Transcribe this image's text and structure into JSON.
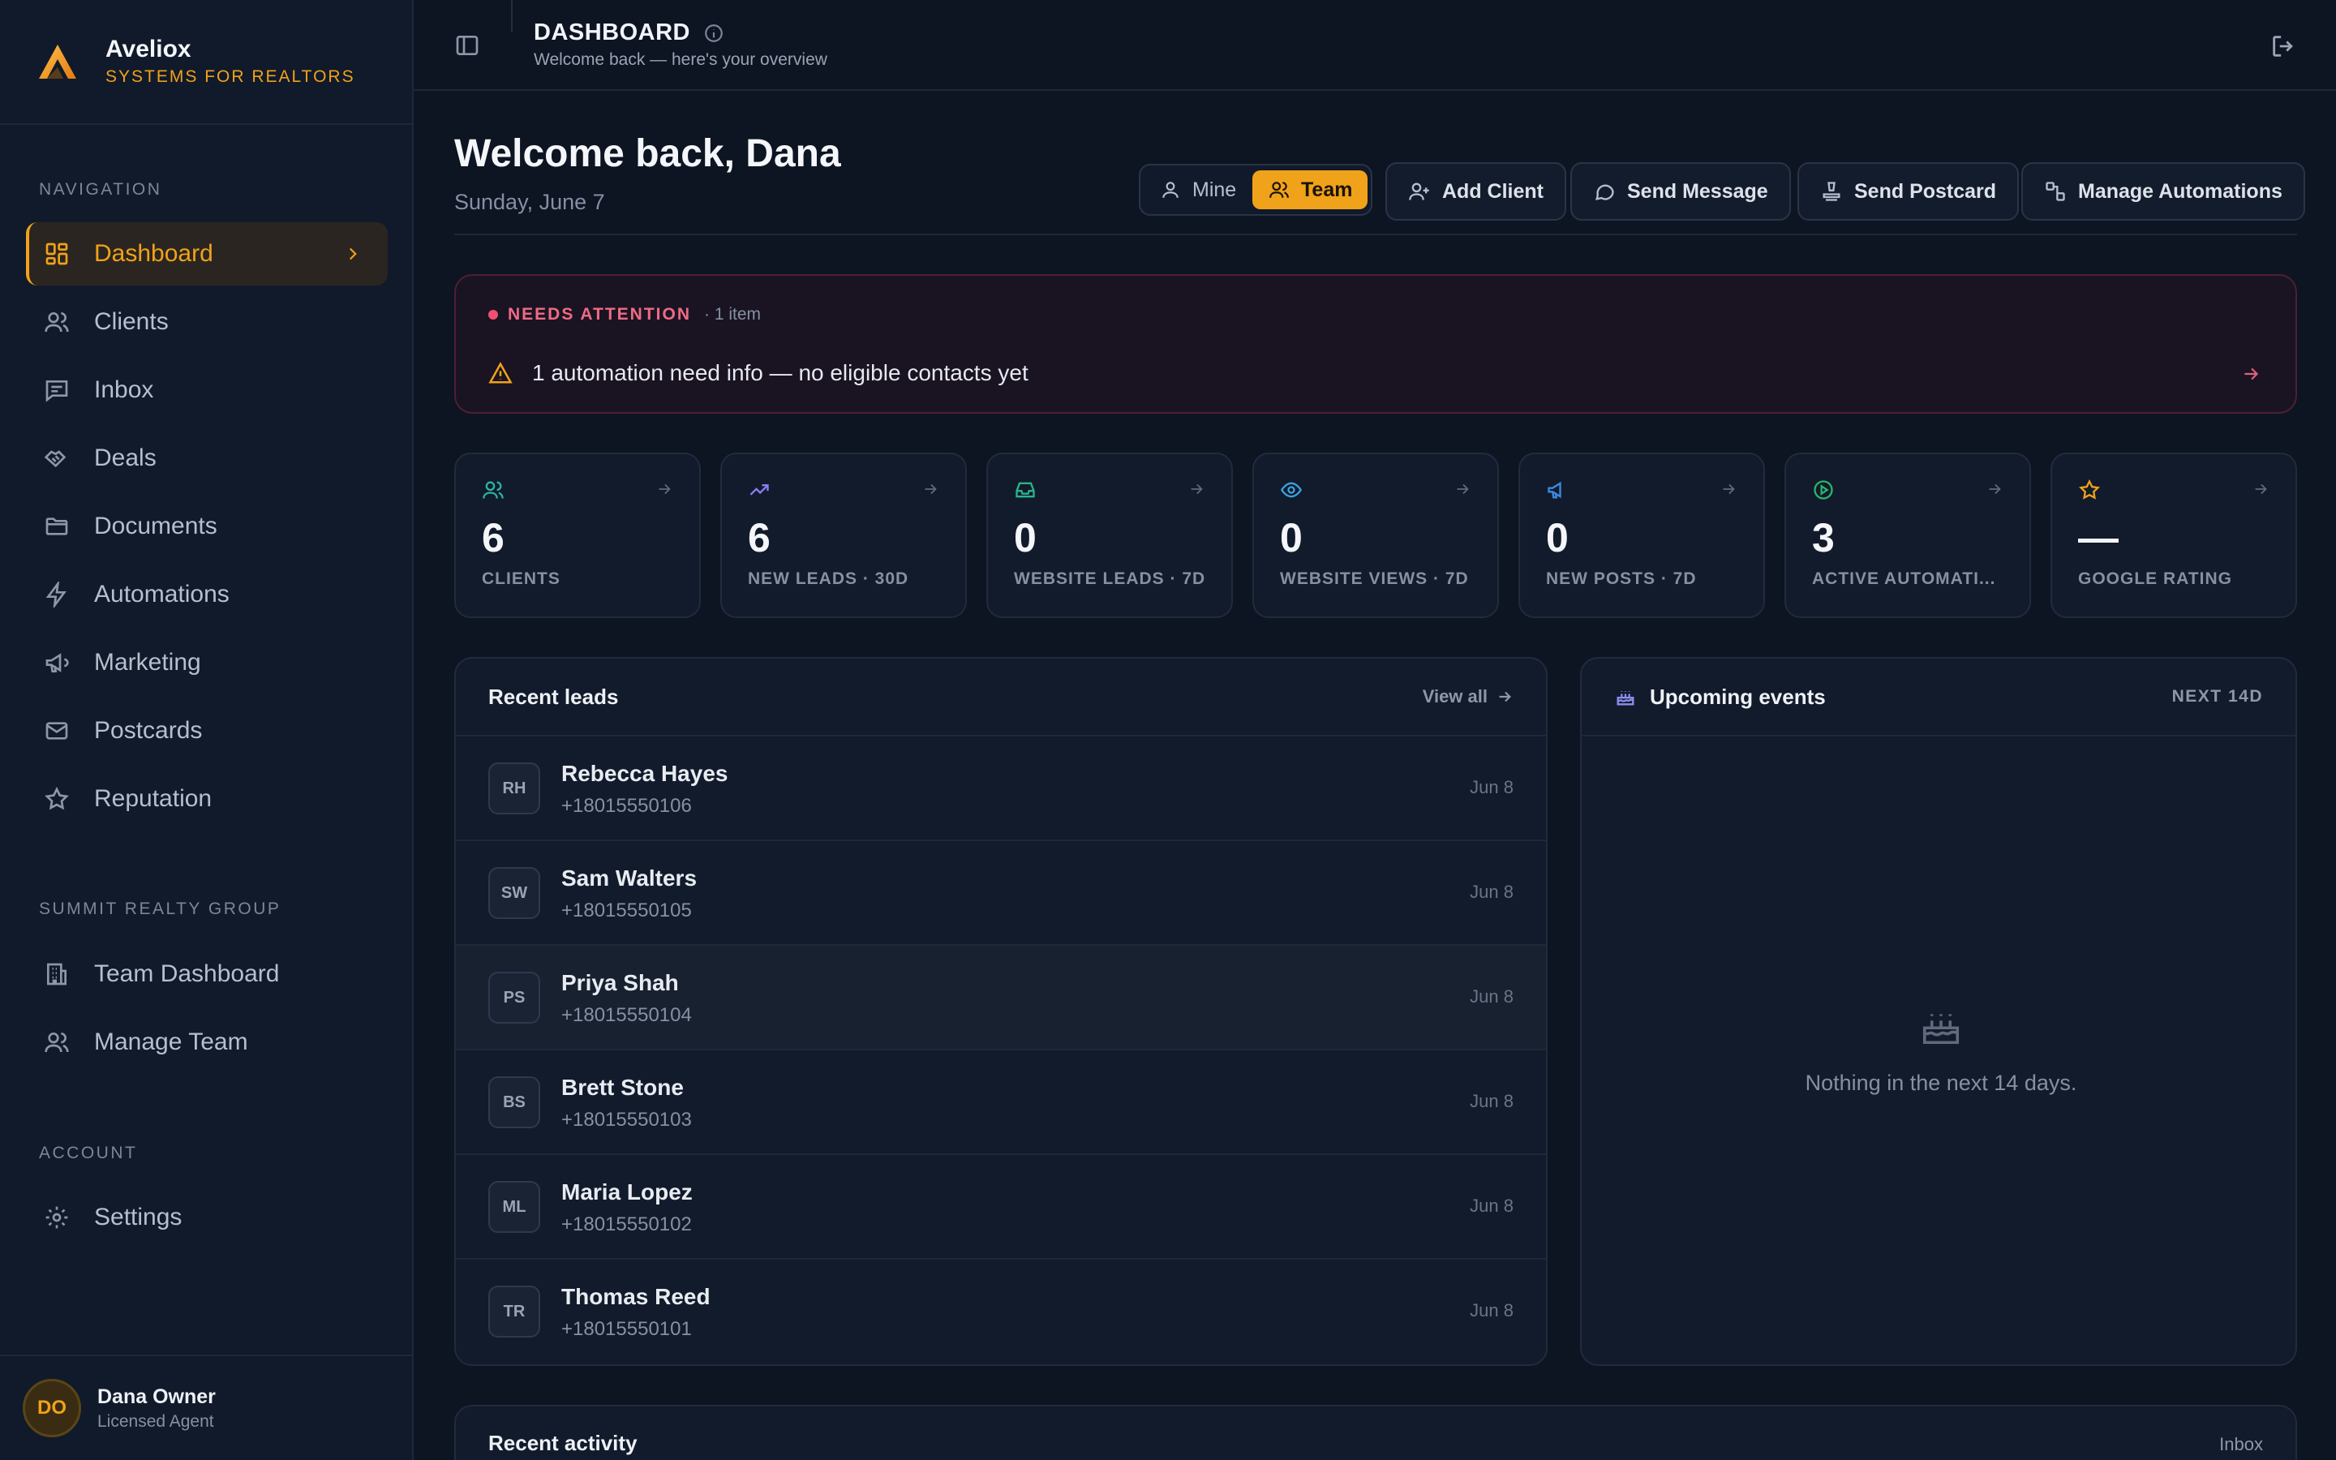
{
  "brand": {
    "name": "Aveliox",
    "tagline": "SYSTEMS FOR REALTORS"
  },
  "sidebar": {
    "sections": {
      "navigation": "NAVIGATION",
      "group": "SUMMIT REALTY GROUP",
      "account": "ACCOUNT"
    },
    "nav": [
      {
        "label": "Dashboard",
        "icon": "dashboard-icon",
        "active": true
      },
      {
        "label": "Clients",
        "icon": "users-icon"
      },
      {
        "label": "Inbox",
        "icon": "message-icon"
      },
      {
        "label": "Deals",
        "icon": "handshake-icon"
      },
      {
        "label": "Documents",
        "icon": "folder-icon"
      },
      {
        "label": "Automations",
        "icon": "lightning-icon"
      },
      {
        "label": "Marketing",
        "icon": "megaphone-icon"
      },
      {
        "label": "Postcards",
        "icon": "mail-icon"
      },
      {
        "label": "Reputation",
        "icon": "star-icon"
      }
    ],
    "group_nav": [
      {
        "label": "Team Dashboard",
        "icon": "building-icon"
      },
      {
        "label": "Manage Team",
        "icon": "users-icon"
      }
    ],
    "account_nav": [
      {
        "label": "Settings",
        "icon": "gear-icon"
      }
    ],
    "user": {
      "initials": "DO",
      "name": "Dana Owner",
      "role": "Licensed Agent"
    }
  },
  "topbar": {
    "title": "DASHBOARD",
    "subtitle": "Welcome back — here's your overview"
  },
  "page": {
    "welcome": "Welcome back, Dana",
    "date": "Sunday, June 7",
    "scope": {
      "mine": "Mine",
      "team": "Team",
      "selected": "Team"
    },
    "actions": {
      "add_client": "Add Client",
      "send_message": "Send Message",
      "send_postcard": "Send Postcard",
      "manage_automations": "Manage Automations"
    }
  },
  "attention": {
    "label": "NEEDS ATTENTION",
    "count": "· 1 item",
    "message": "1 automation need info — no eligible contacts yet"
  },
  "stats": [
    {
      "value": "6",
      "label": "CLIENTS",
      "icon": "users-icon",
      "color": "#2bb3a3"
    },
    {
      "value": "6",
      "label": "NEW LEADS · 30D",
      "icon": "trending-up-icon",
      "color": "#8b7cf0"
    },
    {
      "value": "0",
      "label": "WEBSITE LEADS · 7D",
      "icon": "inbox-tray-icon",
      "color": "#2bb38a"
    },
    {
      "value": "0",
      "label": "WEBSITE VIEWS · 7D",
      "icon": "eye-icon",
      "color": "#3aa0e0"
    },
    {
      "value": "0",
      "label": "NEW POSTS · 7D",
      "icon": "megaphone-icon",
      "color": "#3a8ae0"
    },
    {
      "value": "3",
      "label": "ACTIVE AUTOMATI...",
      "icon": "play-circle-icon",
      "color": "#2bb36a"
    },
    {
      "value": "—",
      "label": "GOOGLE RATING",
      "icon": "star-icon",
      "color": "#f0a21a"
    }
  ],
  "recent_leads": {
    "title": "Recent leads",
    "view_all": "View all",
    "rows": [
      {
        "initials": "RH",
        "name": "Rebecca Hayes",
        "phone": "+18015550106",
        "date": "Jun 8"
      },
      {
        "initials": "SW",
        "name": "Sam Walters",
        "phone": "+18015550105",
        "date": "Jun 8"
      },
      {
        "initials": "PS",
        "name": "Priya Shah",
        "phone": "+18015550104",
        "date": "Jun 8"
      },
      {
        "initials": "BS",
        "name": "Brett Stone",
        "phone": "+18015550103",
        "date": "Jun 8"
      },
      {
        "initials": "ML",
        "name": "Maria Lopez",
        "phone": "+18015550102",
        "date": "Jun 8"
      },
      {
        "initials": "TR",
        "name": "Thomas Reed",
        "phone": "+18015550101",
        "date": "Jun 8"
      }
    ]
  },
  "upcoming_events": {
    "title": "Upcoming events",
    "range": "NEXT 14D",
    "empty": "Nothing in the next 14 days."
  },
  "recent_activity": {
    "title": "Recent activity",
    "link": "Inbox"
  },
  "colors": {
    "accent": "#f0a21a",
    "background": "#0d1422",
    "alert": "#f0506e"
  }
}
